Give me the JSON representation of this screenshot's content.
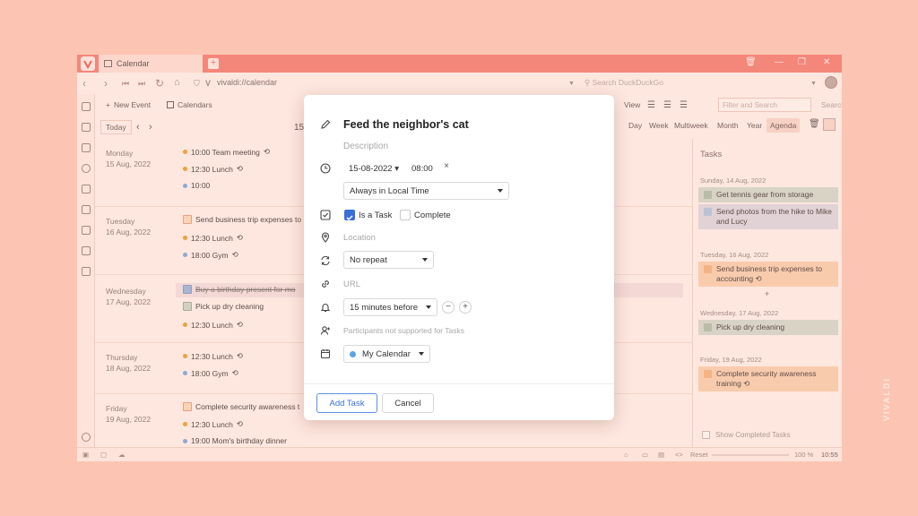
{
  "browser": {
    "tab_title": "Calendar",
    "url": "vivaldi://calendar",
    "search_placeholder": "Search DuckDuckGo"
  },
  "toolbar": {
    "new_event": "New Event",
    "calendars": "Calendars",
    "today": "Today",
    "date_partial": "15",
    "view_label": "View",
    "filter_placeholder": "Filter and Search",
    "search_label": "Search"
  },
  "views": [
    "Day",
    "Week",
    "Multiweek",
    "Month",
    "Year",
    "Agenda"
  ],
  "selected_view": "Agenda",
  "agenda": {
    "days": [
      {
        "weekday": "Monday",
        "date": "15 Aug, 2022"
      },
      {
        "weekday": "Tuesday",
        "date": "16 Aug, 2022"
      },
      {
        "weekday": "Wednesday",
        "date": "17 Aug, 2022"
      },
      {
        "weekday": "Thursday",
        "date": "18 Aug, 2022"
      },
      {
        "weekday": "Friday",
        "date": "19 Aug, 2022"
      }
    ],
    "items": {
      "mon_1": "10:00 Team meeting",
      "mon_2": "12:30 Lunch",
      "mon_3": "10:00",
      "tue_1": "Send business trip expenses to",
      "tue_2": "12:30 Lunch",
      "tue_3": "18:00 Gym",
      "wed_1": "Buy a birthday present for mo",
      "wed_2": "Pick up dry cleaning",
      "wed_3": "12:30 Lunch",
      "thu_1": "12:30 Lunch",
      "thu_2": "18:00 Gym",
      "fri_1": "Complete security awareness t",
      "fri_2": "12:30 Lunch",
      "fri_3": "19:00 Mom's birthday dinner"
    }
  },
  "tasks_panel": {
    "title": "Tasks",
    "groups": [
      {
        "date": "Sunday, 14 Aug, 2022"
      },
      {
        "date": "Tuesday, 16 Aug, 2022"
      },
      {
        "date": "Wednesday, 17 Aug, 2022"
      },
      {
        "date": "Friday, 19 Aug, 2022"
      }
    ],
    "items": {
      "t1": "Get tennis gear from storage",
      "t2": "Send photos from the hike to Mike and Lucy",
      "t3": "Send business trip expenses to accounting",
      "t4": "Pick up dry cleaning",
      "t5": "Complete security awareness training"
    },
    "plus": "+",
    "show_completed": "Show Completed Tasks"
  },
  "statusbar": {
    "reset": "Reset",
    "zoom": "100 %",
    "time": "10:55"
  },
  "modal": {
    "title": "Feed the neighbor's cat",
    "description_placeholder": "Description",
    "date": "15-08-2022",
    "time": "08:00",
    "timezone": "Always in Local Time",
    "is_task_label": "Is a Task",
    "is_task": true,
    "complete_label": "Complete",
    "complete": false,
    "location_placeholder": "Location",
    "repeat": "No repeat",
    "url_placeholder": "URL",
    "reminder": "15 minutes before",
    "participants_note": "Participants not supported for Tasks",
    "calendar": "My Calendar",
    "calendar_color": "#5aa3e8",
    "add_button": "Add Task",
    "cancel_button": "Cancel"
  },
  "watermark": "VIVALDI"
}
